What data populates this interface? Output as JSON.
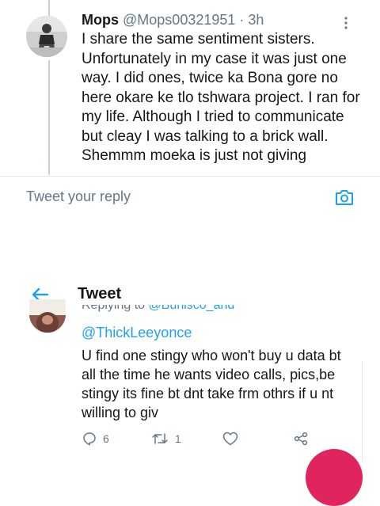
{
  "reply_tweet": {
    "display_name": "Mops",
    "handle": "@Mops00321951",
    "separator": "·",
    "time": "3h",
    "lines": [
      "I share the same sentiment sisters.",
      "Unfortunately in my case it was just one",
      "way. I did ones, twice ka Bona gore no",
      "here okare ke tlo tshwara project. I ran for",
      "my life. Although I tried to communicate",
      "but cleay I was talking to a brick wall.",
      "Shemmm moeka is just not giving"
    ]
  },
  "reply_box": {
    "placeholder": "Tweet your reply",
    "camera_icon": "camera-icon"
  },
  "header": {
    "title": "Tweet",
    "back_icon": "arrow-left-icon"
  },
  "tweet": {
    "replying_prefix": "Replying to ",
    "replying_handle": "@Bunisco_and",
    "mention": "@ThickLeeyonce",
    "lines": [
      "U find one stingy who won't buy u data bt",
      "all the time he wants video calls, pics,be",
      "stingy its fine bt dnt take frm othrs if u nt",
      "willing to giv"
    ],
    "actions": {
      "reply_count": "6",
      "retweet_count": "1",
      "like_count": "",
      "share_count": ""
    }
  },
  "colors": {
    "accent": "#1da1f2",
    "secondary_text": "#657786",
    "divider": "#e1e8ed",
    "fab": "#e0245e"
  }
}
